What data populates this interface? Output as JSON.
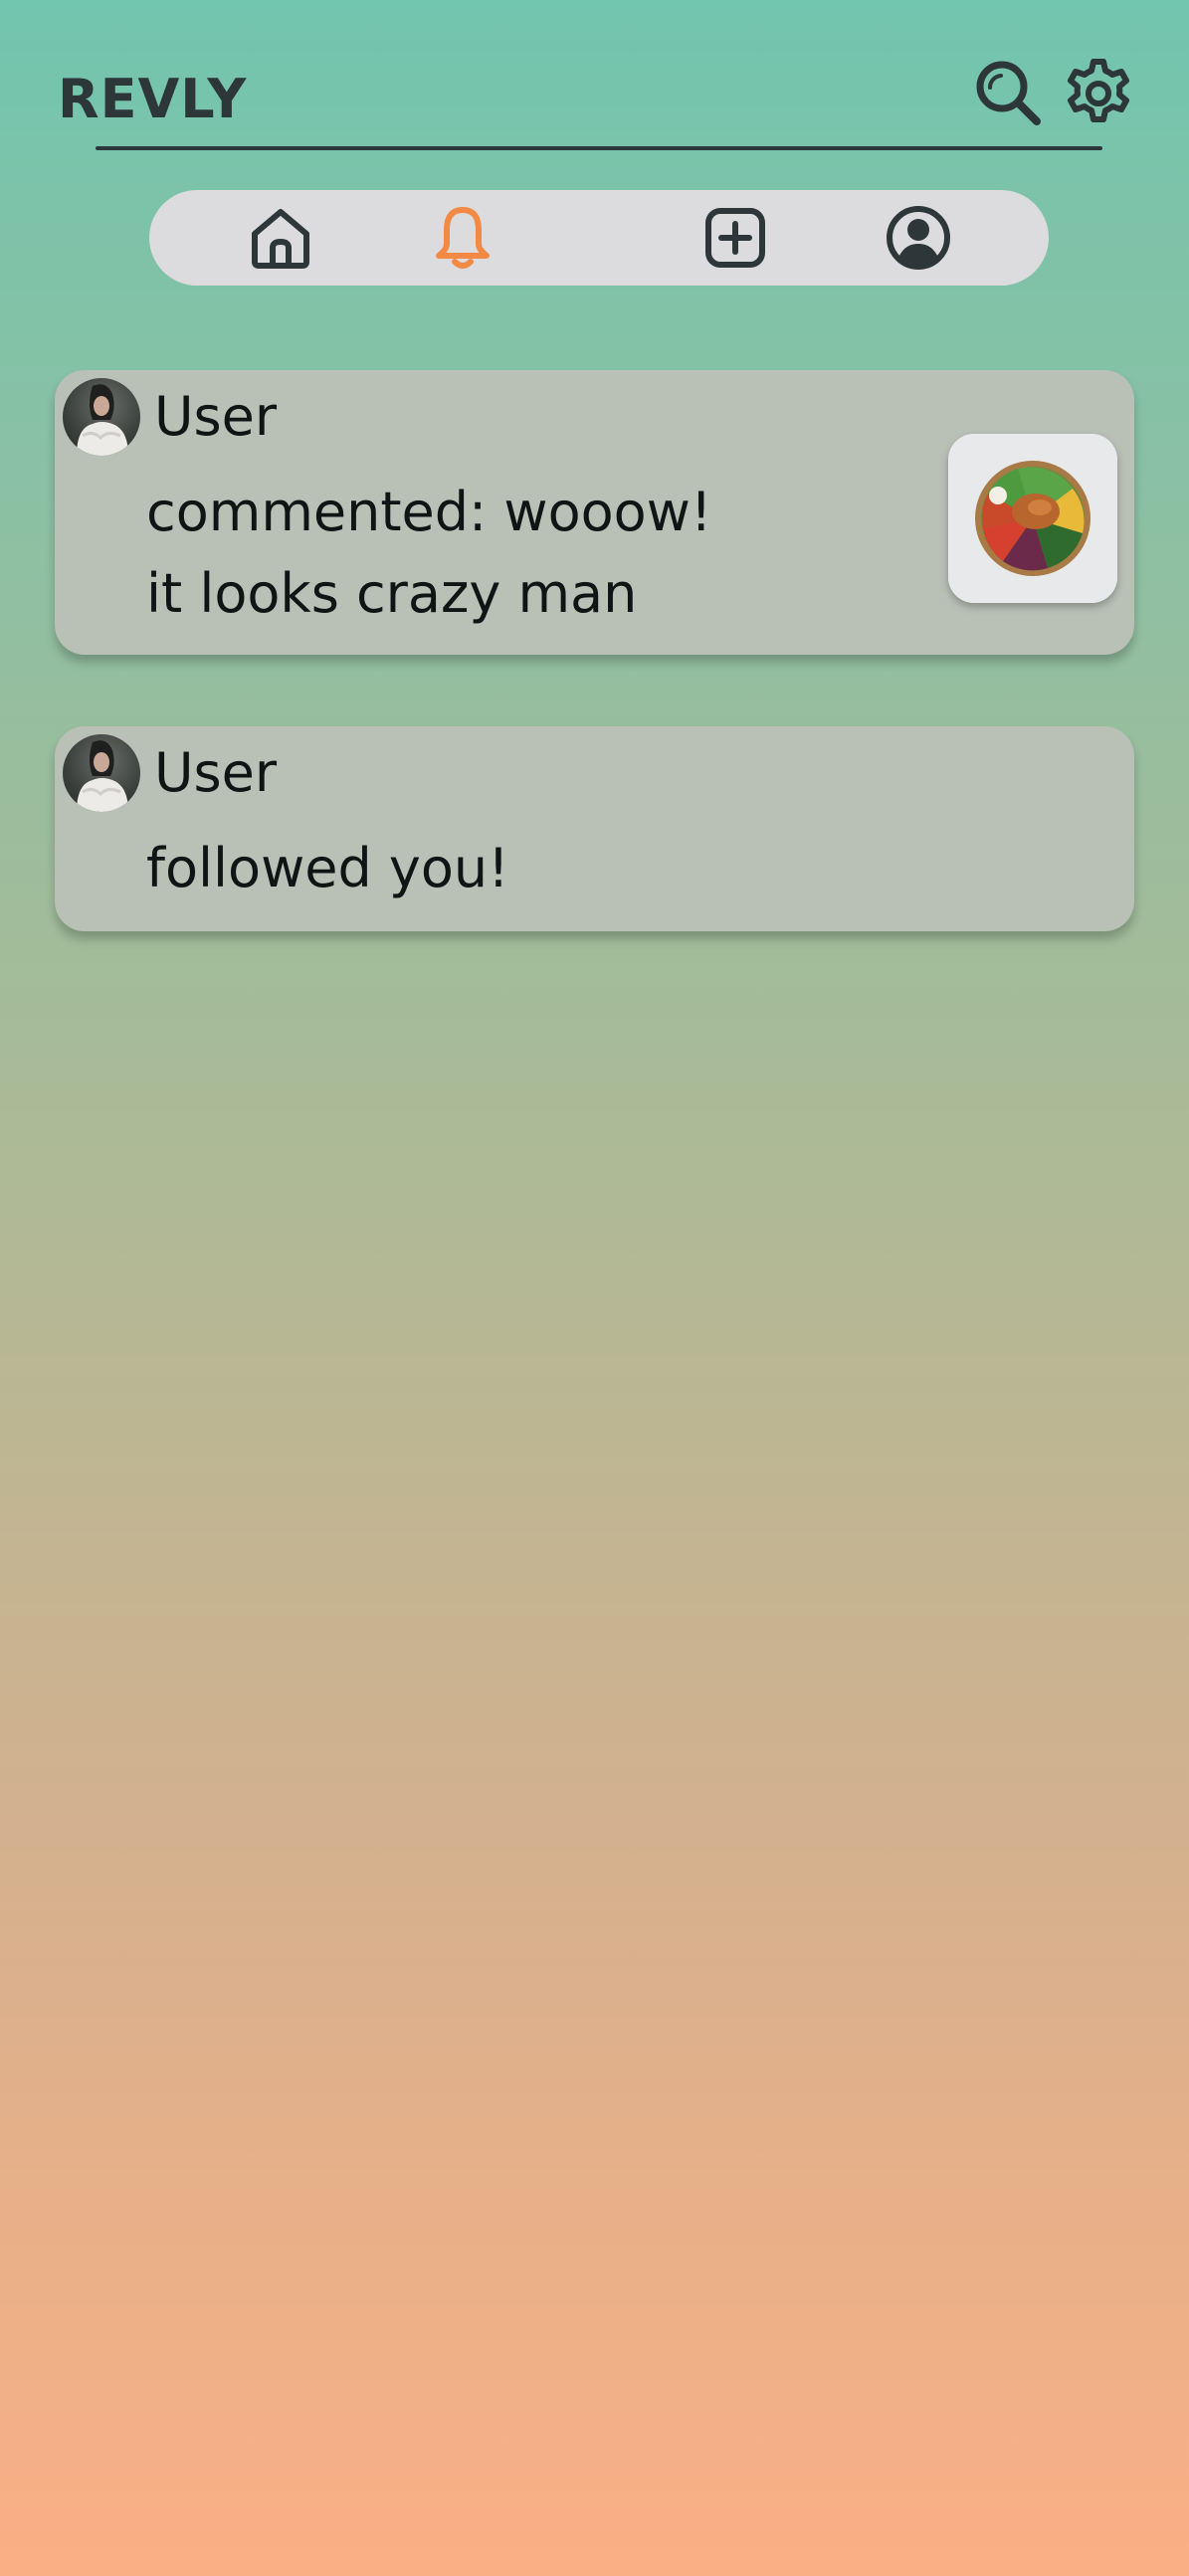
{
  "header": {
    "title": "REVLY",
    "search_icon": "search-icon",
    "settings_icon": "gear-icon"
  },
  "nav": {
    "items": [
      {
        "icon": "home-icon",
        "active": false
      },
      {
        "icon": "bell-icon",
        "active": true
      },
      {
        "icon": "plus-square-icon",
        "active": false
      },
      {
        "icon": "user-circle-icon",
        "active": false
      }
    ],
    "active_color": "#f28a45",
    "inactive_color": "#2d3638"
  },
  "notifications": [
    {
      "user": "User",
      "message": "commented: wooow! it looks crazy man",
      "has_thumbnail": true
    },
    {
      "user": "User",
      "message": "followed you!",
      "has_thumbnail": false
    }
  ],
  "colors": {
    "gradient_top": "#72c5ae",
    "gradient_bottom": "#fbaf84",
    "card_bg": "#b9c0b6",
    "nav_bg": "#dcdcde"
  }
}
